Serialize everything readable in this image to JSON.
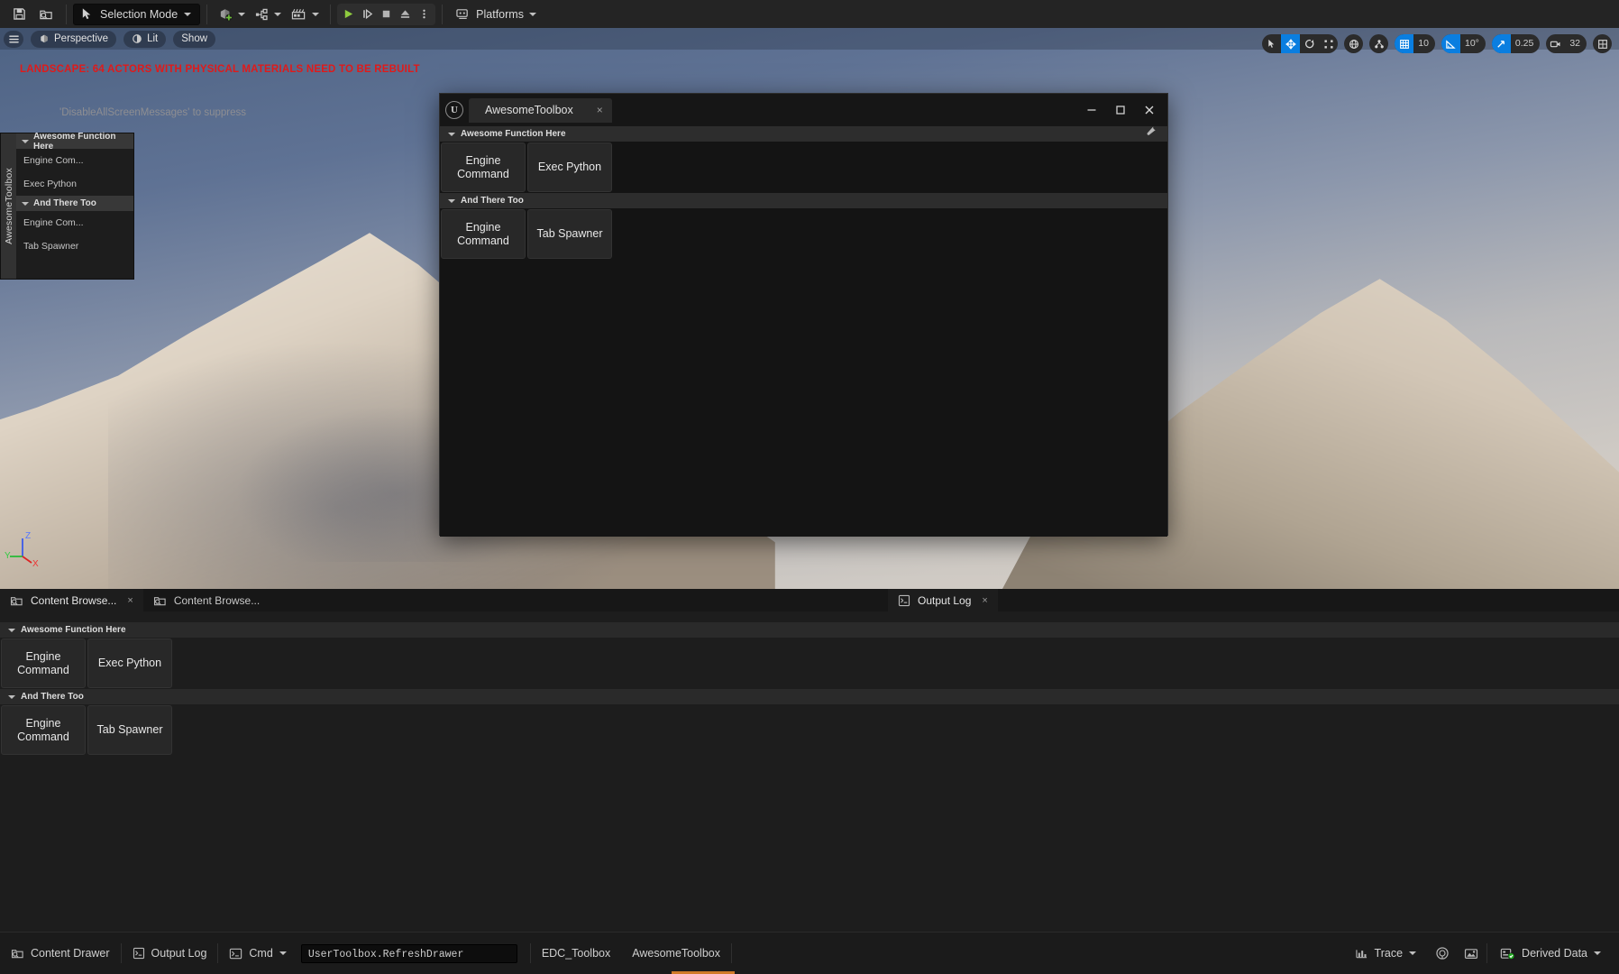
{
  "toolbar": {
    "save_icon": "save-icon",
    "browse_icon": "browse-content-icon",
    "mode_label": "Selection Mode",
    "add_icon": "add-actor-icon",
    "blueprint_icon": "blueprint-icon",
    "cinematics_icon": "cinematics-icon",
    "play_icon": "play-icon",
    "step_icon": "step-icon",
    "stop_icon": "stop-icon",
    "eject_icon": "eject-icon",
    "more_icon": "more-options-icon",
    "platforms_label": "Platforms"
  },
  "viewport": {
    "menu_icon": "viewport-menu-icon",
    "perspective_label": "Perspective",
    "lit_label": "Lit",
    "show_label": "Show",
    "warning_text": "LANDSCAPE: 64 ACTORS WITH PHYSICAL MATERIALS NEED TO BE REBUILT",
    "warning_hint": "'DisableAllScreenMessages' to suppress",
    "axis_x": "X",
    "axis_y": "Y",
    "axis_z": "Z",
    "tools": {
      "select_icon": "select-cursor-icon",
      "move_icon": "move-gizmo-icon",
      "rotate_icon": "rotate-gizmo-icon",
      "scale_icon": "scale-gizmo-icon",
      "world_icon": "world-coordinates-icon",
      "snap_icon": "surface-snap-icon",
      "grid_icon": "grid-snap-icon",
      "grid_value": "10",
      "angle_icon": "angle-snap-icon",
      "angle_value": "10°",
      "scale_snap_icon": "scale-snap-icon",
      "scale_value": "0.25",
      "camera_icon": "camera-speed-icon",
      "camera_value": "32",
      "maximize_icon": "maximize-viewport-icon"
    }
  },
  "left_dock": {
    "tab_label": "AwesomeToolbox",
    "sections": [
      {
        "title": "Awesome Function Here",
        "items": [
          "Engine Com...",
          "Exec Python"
        ]
      },
      {
        "title": "And There Too",
        "items": [
          "Engine Com...",
          "Tab Spawner"
        ]
      }
    ]
  },
  "float_window": {
    "logo_text": "U",
    "tab_label": "AwesomeToolbox",
    "tab_close": "×",
    "minimize_icon": "minimize-icon",
    "maximize_icon": "maximize-icon",
    "close_icon": "close-icon",
    "wrench_icon": "wrench-icon",
    "sections": [
      {
        "title": "Awesome Function Here",
        "buttons": [
          "Engine\nCommand",
          "Exec Python"
        ]
      },
      {
        "title": "And There Too",
        "buttons": [
          "Engine\nCommand",
          "Tab Spawner"
        ]
      }
    ]
  },
  "bottom_dock": {
    "tabs": [
      {
        "label": "Content Browse...",
        "icon": "content-browser-icon",
        "active": true,
        "closable": true
      },
      {
        "label": "Content Browse...",
        "icon": "content-browser-icon",
        "active": false,
        "closable": false
      }
    ],
    "output_log_tab": {
      "label": "Output Log",
      "icon": "output-log-icon",
      "close": "×"
    },
    "sections": [
      {
        "title": "Awesome Function Here",
        "buttons": [
          "Engine\nCommand",
          "Exec Python"
        ]
      },
      {
        "title": "And There Too",
        "buttons": [
          "Engine\nCommand",
          "Tab Spawner"
        ]
      }
    ]
  },
  "status_bar": {
    "content_drawer_label": "Content Drawer",
    "content_drawer_icon": "content-drawer-icon",
    "output_log_label": "Output Log",
    "output_log_icon": "output-log-icon",
    "cmd_label": "Cmd",
    "cmd_icon": "console-icon",
    "cmd_value": "UserToolbox.RefreshDrawer",
    "edc_toolbox_label": "EDC_Toolbox",
    "awesome_toolbox_label": "AwesomeToolbox",
    "trace_label": "Trace",
    "trace_icon": "trace-icon",
    "tray_icon_1": "source-control-icon",
    "tray_icon_2": "screenshot-icon",
    "derived_data_label": "Derived Data",
    "derived_data_icon": "derived-data-icon"
  },
  "colors": {
    "accent_blue": "#0a7ee0",
    "warning_red": "#e01a1a",
    "play_green": "#8fcb3f",
    "status_green": "#1fa81f",
    "panel_dark": "#1d1d1d",
    "orange": "#d07a28"
  }
}
